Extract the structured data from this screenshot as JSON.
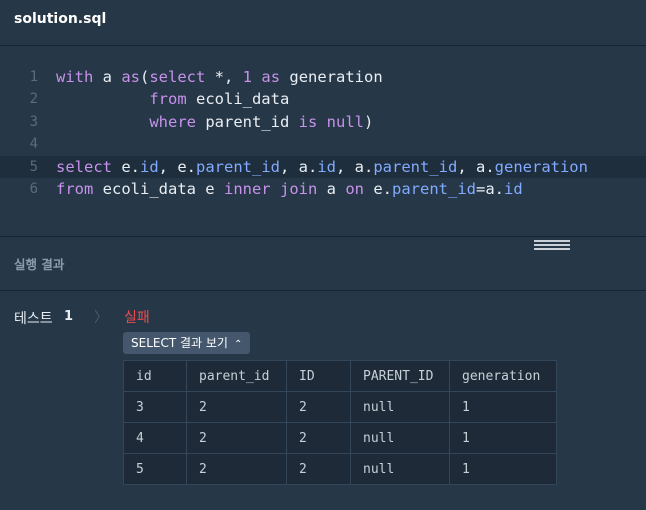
{
  "file": {
    "name": "solution.sql"
  },
  "editor": {
    "lines": [
      {
        "num": "1",
        "tokens": [
          [
            "kw",
            "with"
          ],
          [
            "pl",
            " a "
          ],
          [
            "kw",
            "as"
          ],
          [
            "pl",
            "("
          ],
          [
            "kw",
            "select"
          ],
          [
            "pl",
            " *, "
          ],
          [
            "num",
            "1"
          ],
          [
            "pl",
            " "
          ],
          [
            "kw",
            "as"
          ],
          [
            "pl",
            " generation"
          ]
        ]
      },
      {
        "num": "2",
        "tokens": [
          [
            "pl",
            "          "
          ],
          [
            "kw",
            "from"
          ],
          [
            "pl",
            " ecoli_data"
          ]
        ]
      },
      {
        "num": "3",
        "tokens": [
          [
            "pl",
            "          "
          ],
          [
            "kw",
            "where"
          ],
          [
            "pl",
            " parent_id "
          ],
          [
            "kw",
            "is"
          ],
          [
            "pl",
            " "
          ],
          [
            "kw",
            "null"
          ],
          [
            "pl",
            ")"
          ]
        ]
      },
      {
        "num": "4",
        "tokens": []
      },
      {
        "num": "5",
        "active": true,
        "tokens": [
          [
            "kw",
            "select"
          ],
          [
            "pl",
            " e."
          ],
          [
            "prop",
            "id"
          ],
          [
            "pl",
            ", e."
          ],
          [
            "prop",
            "parent_id"
          ],
          [
            "pl",
            ", a."
          ],
          [
            "prop",
            "id"
          ],
          [
            "pl",
            ", a."
          ],
          [
            "prop",
            "parent_id"
          ],
          [
            "pl",
            ", a."
          ],
          [
            "prop",
            "generation"
          ]
        ]
      },
      {
        "num": "6",
        "tokens": [
          [
            "kw",
            "from"
          ],
          [
            "pl",
            " ecoli_data e "
          ],
          [
            "kw",
            "inner"
          ],
          [
            "pl",
            " "
          ],
          [
            "kw",
            "join"
          ],
          [
            "pl",
            " a "
          ],
          [
            "kw",
            "on"
          ],
          [
            "pl",
            " e."
          ],
          [
            "prop",
            "parent_id"
          ],
          [
            "pl",
            "=a."
          ],
          [
            "prop",
            "id"
          ]
        ]
      }
    ]
  },
  "result": {
    "title": "실행 결과",
    "test_label": "테스트",
    "test_number": "1",
    "status": "실패",
    "select_button": "SELECT 결과 보기",
    "columns": [
      "id",
      "parent_id",
      "ID",
      "PARENT_ID",
      "generation"
    ],
    "rows": [
      [
        "3",
        "2",
        "2",
        "null",
        "1"
      ],
      [
        "4",
        "2",
        "2",
        "null",
        "1"
      ],
      [
        "5",
        "2",
        "2",
        "null",
        "1"
      ]
    ]
  },
  "colors": {
    "fail": "#f24b4b",
    "keyword": "#c792ea",
    "property": "#82aaff",
    "background": "#263747"
  }
}
